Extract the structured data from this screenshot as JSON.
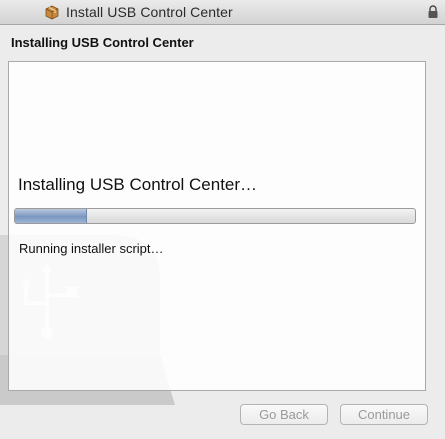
{
  "window": {
    "title": "Install USB Control Center",
    "title_icon": "package-icon",
    "lock_icon": "lock-icon"
  },
  "step": {
    "heading": "Installing USB Control Center"
  },
  "main": {
    "status": "Installing USB Control Center…",
    "detail": "Running installer script…",
    "progress_fraction": 0.18,
    "watermark_icon": "usb-icon"
  },
  "buttons": {
    "back_label": "Go Back",
    "continue_label": "Continue"
  },
  "colors": {
    "window_background": "#ececec",
    "progress_fill": "#7a97bf",
    "disabled_button_text": "#9a9a9a"
  }
}
